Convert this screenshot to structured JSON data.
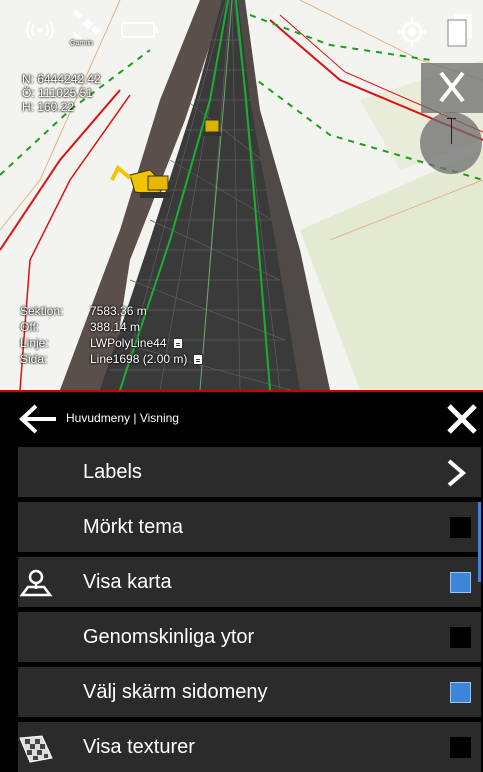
{
  "overlay": {
    "coords": [
      "N: 6444242.42",
      "Ö: 111025.51",
      "H: 160.22"
    ],
    "info": [
      {
        "key": "Sektion:",
        "value": "7583.36 m",
        "doc": false
      },
      {
        "key": "Off:",
        "value": "388.14 m",
        "doc": false
      },
      {
        "key": "Linje:",
        "value": "LWPolyLine44",
        "doc": true
      },
      {
        "key": "Sida:",
        "value": "Line1698 (2.00 m)",
        "doc": true
      }
    ],
    "gps_sublabel": "Garmin"
  },
  "menu": {
    "breadcrumb": "Huvudmeny | Visning",
    "items": [
      {
        "label": "Labels",
        "control": "chevron",
        "checked": false,
        "icon": ""
      },
      {
        "label": "Mörkt tema",
        "control": "checkbox",
        "checked": false,
        "icon": ""
      },
      {
        "label": "Visa karta",
        "control": "checkbox",
        "checked": true,
        "icon": "map-pin-icon"
      },
      {
        "label": "Genomskinliga ytor",
        "control": "checkbox",
        "checked": false,
        "icon": ""
      },
      {
        "label": "Välj skärm sidomeny",
        "control": "checkbox",
        "checked": true,
        "icon": ""
      },
      {
        "label": "Visa texturer",
        "control": "checkbox",
        "checked": false,
        "icon": "texture-icon"
      }
    ]
  },
  "colors": {
    "accent": "#3d85d8",
    "menu_item_bg": "#2b2b2b",
    "divider": "#cc0000",
    "road": "#3a3a3a",
    "terrain": "#e4ead2"
  }
}
